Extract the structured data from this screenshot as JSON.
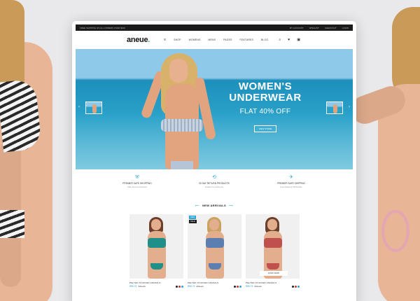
{
  "topbar": {
    "left": "FREE SHIPPING ON ALL ORDERS OVER $100",
    "links": [
      "MY ACCOUNT",
      "WISHLIST",
      "CHECKOUT",
      "LOGIN"
    ]
  },
  "nav": {
    "logo": "aneue",
    "logo_dot": ".",
    "menu_icon": "hamburger-icon",
    "menu": [
      "SHOP",
      "WOMENS",
      "MENS",
      "PAGES",
      "FEATURES",
      "BLOG"
    ],
    "icons": [
      "search-icon",
      "heart-icon",
      "cart-icon"
    ]
  },
  "hero": {
    "title": "WOMEN'S\nUNDERWEAR",
    "subtitle": "FLAT 40% OFF",
    "button": "VIEW STORE",
    "prev_arrow": "‹",
    "next_arrow": "›"
  },
  "features": [
    {
      "icon": "shield-icon",
      "glyph": "⛨",
      "title": "PREMIER SAFE SHOPPING",
      "sub": "Safe Secure Checkout"
    },
    {
      "icon": "return-icon",
      "glyph": "⟲",
      "title": "30 DAY RETURN PRODUCTS",
      "sub": "Hassle Free Returns"
    },
    {
      "icon": "plane-icon",
      "glyph": "✈",
      "title": "PREMIER SAFE SHIPPING",
      "sub": "Free Shipping Worldwide"
    }
  ],
  "section": {
    "title": "NEW ARRIVALS",
    "deco_left": "⟵",
    "deco_right": "⟶"
  },
  "products": [
    {
      "name": "PELTED STUFFED ANIMALS",
      "price": "$56.74",
      "old": "$86.00",
      "top_color": "#1f8f8a",
      "bottom_color": "#1f8f8a",
      "swatches": [
        "#222222",
        "#c0392b",
        "#2aa5d6"
      ]
    },
    {
      "name": "PELTED STUFFED ANIMALS",
      "price": "$56.74",
      "old": "$86.00",
      "top_color": "#5a7fb0",
      "bottom_color": "#5a7fb0",
      "badge_new": "NEW",
      "badge_sale": "SALE",
      "swatches": [
        "#222222",
        "#c0392b",
        "#2aa5d6"
      ]
    },
    {
      "name": "PELTED STUFFED ANIMALS",
      "price": "$56.74",
      "old": "$86.00",
      "top_color": "#c0504d",
      "bottom_color": "#c0504d",
      "quick": "QUICK SHOP",
      "swatches": [
        "#222222",
        "#c0392b",
        "#2aa5d6"
      ]
    }
  ],
  "colors": {
    "accent": "#2aa5d6",
    "topbar": "#1b1b1b"
  }
}
